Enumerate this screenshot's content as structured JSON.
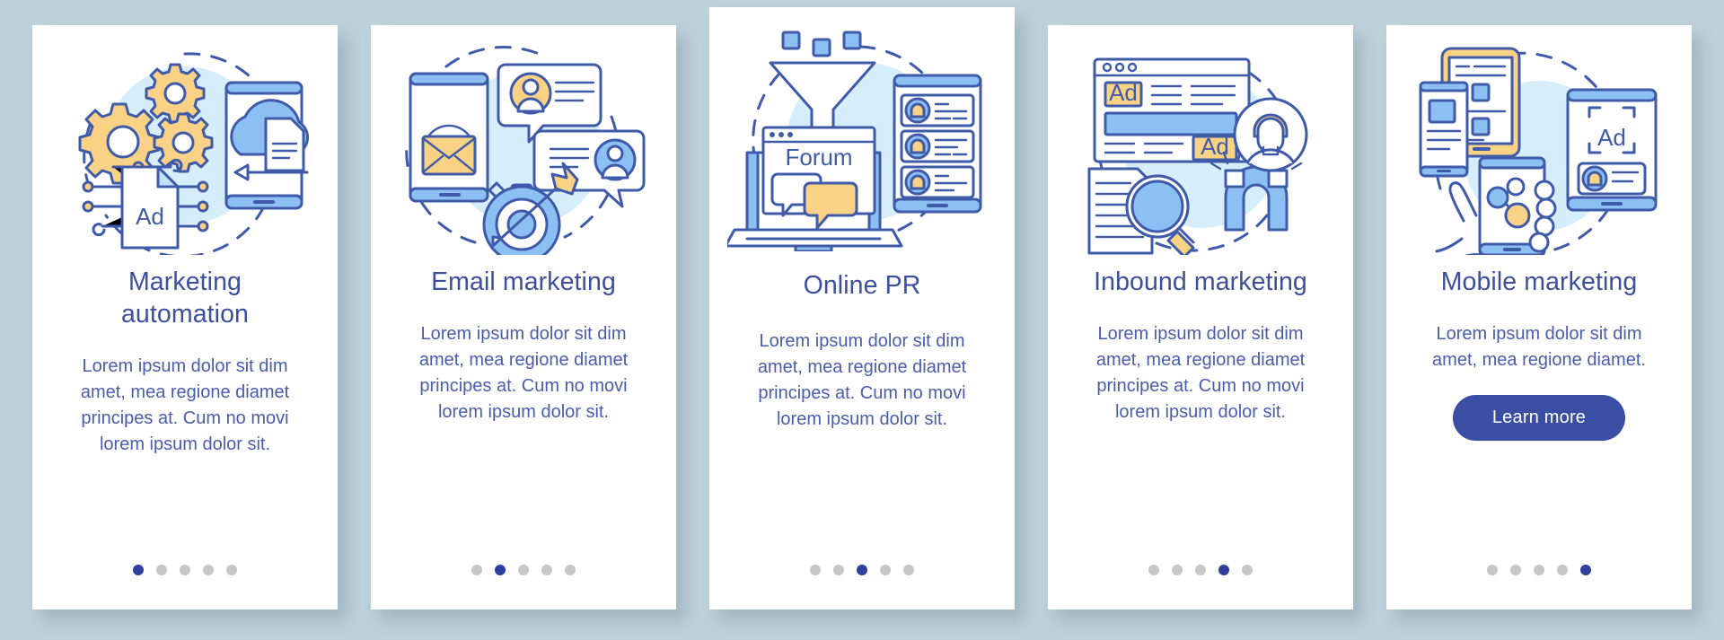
{
  "background_color": "#bdd1db",
  "theme": {
    "title_color": "#3c4f9e",
    "body_color": "#4a5cab",
    "accent_color": "#3a4ea3",
    "dot_inactive_color": "#c6c6c6",
    "card_background": "#ffffff",
    "illustration_outline": "#3f5aa9",
    "illustration_yellow": "#fad286",
    "illustration_blue": "#8cc0f2",
    "illustration_halo": "#d6eefb"
  },
  "cards": [
    {
      "id": "marketing-automation",
      "title": "Marketing\nautomation",
      "title_line1": "Marketing",
      "title_line2": "automation",
      "body": "Lorem ipsum dolor sit dim amet, mea regione diamet principes at. Cum no movi lorem ipsum dolor sit.",
      "illustration_name": "marketing-automation-illustration",
      "illustration_elements": [
        "gears",
        "ad-document",
        "circuit-lines",
        "smartphone",
        "cloud",
        "file",
        "arrow",
        "dashed-circle"
      ],
      "illustration_labels": [
        "Ad"
      ],
      "dots": {
        "count": 5,
        "active_index": 0
      },
      "featured": false,
      "has_cta": false
    },
    {
      "id": "email-marketing",
      "title": "Email marketing",
      "body": "Lorem ipsum dolor sit dim amet, mea regione diamet principes at. Cum no movi lorem ipsum dolor sit.",
      "illustration_name": "email-marketing-illustration",
      "illustration_elements": [
        "smartphone",
        "wifi-waves",
        "envelope",
        "chat-bubble-avatar-yellow",
        "chat-bubble-avatar-blue",
        "target-stopwatch",
        "arrow",
        "dashed-circle"
      ],
      "illustration_labels": [],
      "dots": {
        "count": 5,
        "active_index": 1
      },
      "featured": false,
      "has_cta": false
    },
    {
      "id": "online-pr",
      "title": "Online PR",
      "body": "Lorem ipsum dolor sit dim amet, mea regione diamet principes at. Cum no movi lorem ipsum dolor sit.",
      "illustration_name": "online-pr-illustration",
      "illustration_elements": [
        "funnel",
        "squares",
        "laptop",
        "forum-screen",
        "chat-bubbles",
        "tablet-contact-list",
        "dashed-circle"
      ],
      "illustration_labels": [
        "Forum"
      ],
      "dots": {
        "count": 5,
        "active_index": 2
      },
      "featured": true,
      "has_cta": false
    },
    {
      "id": "inbound-marketing",
      "title": "Inbound marketing",
      "body": "Lorem ipsum dolor sit dim amet, mea regione diamet principes at. Cum no movi lorem ipsum dolor sit.",
      "illustration_name": "inbound-marketing-illustration",
      "illustration_elements": [
        "browser-window",
        "ad-banner",
        "document",
        "magnifying-glass",
        "magnet",
        "user-avatar",
        "dashed-circle"
      ],
      "illustration_labels": [
        "Ad",
        "Ad"
      ],
      "dots": {
        "count": 5,
        "active_index": 3
      },
      "featured": false,
      "has_cta": false
    },
    {
      "id": "mobile-marketing",
      "title": "Mobile marketing",
      "body": "Lorem ipsum dolor sit dim amet, mea regione diamet.",
      "illustration_name": "mobile-marketing-illustration",
      "illustration_elements": [
        "tablet-yellow",
        "smartphone",
        "hand-holding-phone",
        "network-graph",
        "tablet-ad",
        "contact-card",
        "dashed-circle"
      ],
      "illustration_labels": [
        "Ad"
      ],
      "dots": {
        "count": 5,
        "active_index": 4
      },
      "featured": false,
      "has_cta": true,
      "cta_label": "Learn more"
    }
  ]
}
